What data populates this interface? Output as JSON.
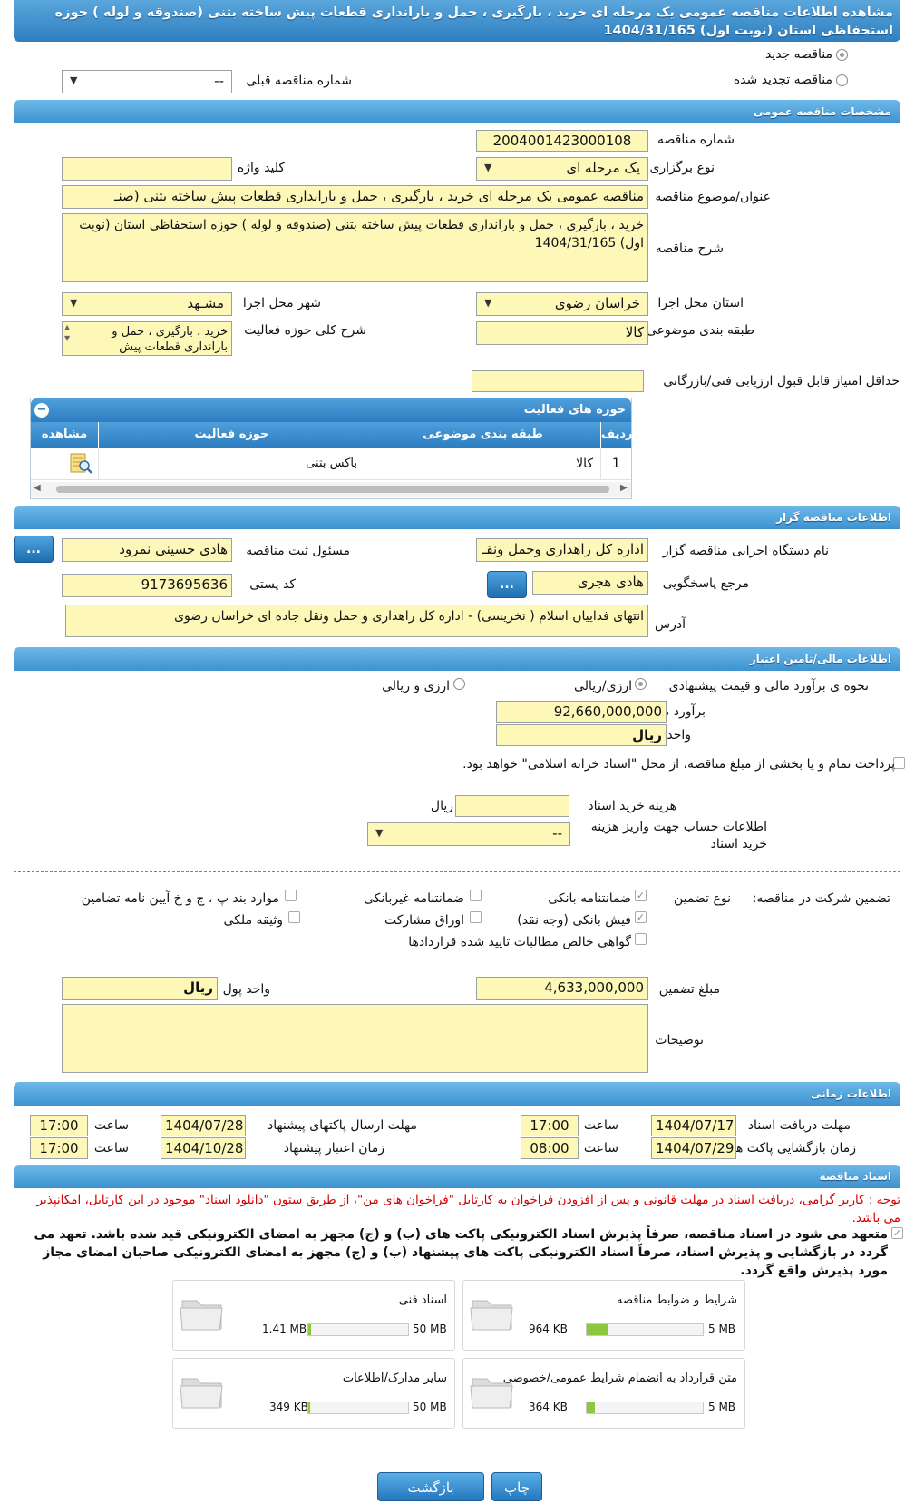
{
  "header": {
    "title": "مشاهده اطلاعات مناقصه عمومی یک مرحله ای خرید ، بارگیری ، حمل و بارانداری قطعات پیش ساخته بتنی (صندوقه و لوله ) حوزه استحفاظی استان (نوبت اول) 1404/31/165"
  },
  "tender_kind": {
    "new_label": "مناقصه جدید",
    "renewed_label": "مناقصه تجدید شده",
    "previous_number_label": "شماره مناقصه قبلی",
    "previous_number_value": "--"
  },
  "general": {
    "section_title": "مشخصات مناقصه عمومی",
    "number_label": "شماره مناقصه",
    "number_value": "2004001423000108",
    "holding_type_label": "نوع برگزاری",
    "holding_type_value": "یک مرحله ای",
    "keyword_label": "کلید واژه",
    "keyword_value": "",
    "subject_label": "عنوان/موضوع مناقصه",
    "subject_value": "مناقصه عمومی یک مرحله ای خرید ، بارگیری ، حمل و بارانداری قطعات پیش ساخته بتنی (صنـ",
    "description_label": "شرح مناقصه",
    "description_value": "خرید ، بارگیری ، حمل و بارانداری قطعات پیش ساخته بتنی (صندوقه و لوله ) حوزه استحفاظی استان (نوبت اول) 1404/31/165",
    "province_label": "استان محل اجرا",
    "province_value": "خراسان رضوی",
    "city_label": "شهر محل اجرا",
    "city_value": "مشـهد",
    "category_label": "طبقه بندی موضوعی",
    "category_value": "کالا",
    "activity_desc_label": "شرح کلی حوزه فعالیت",
    "activity_desc_value": "خرید ، بارگیری ، حمل و بارانداری قطعات پیش",
    "min_score_label": "حداقل امتیاز قابل قبول ارزیابی فنی/بازرگانی",
    "min_score_value": ""
  },
  "activity_grid": {
    "title": "حوزه های فعالیت",
    "columns": [
      "ردیف",
      "طبقه بندی موضوعی",
      "حوزه فعالیت",
      "مشاهده"
    ],
    "rows": [
      {
        "row": "1",
        "category": "کالا",
        "field": "باکس بتنی"
      }
    ]
  },
  "organizer": {
    "section_title": "اطلاعات مناقصه گزار",
    "org_name_label": "نام دستگاه اجرایی مناقصه گزار",
    "org_name_value": "اداره کل راهداری وحمل ونقـ",
    "registrar_label": "مسئول ثبت مناقصه",
    "registrar_value": "هادی حسینی نمرود",
    "responder_label": "مرجع پاسخگویی",
    "responder_value": "هادی هجری",
    "postal_code_label": "کد پستی",
    "postal_code_value": "9173695636",
    "address_label": "آدرس",
    "address_value": "انتهای فداییان اسلام ( نخریسی) - اداره کل راهداری و حمل ونقل جاده ای خراسان رضوی",
    "dots_label": "..."
  },
  "finance": {
    "section_title": "اطلاعات مالی/تامین اعتبار",
    "method_label": "نحوه ی برآورد مالی و قیمت پیشنهادی",
    "option_currency_rial": "ارزی/ریالی",
    "option_currency_and_rial": "ارزی و ریالی",
    "estimate_label": "برآورد مالی",
    "estimate_value": "92,660,000,000",
    "currency_label": "واحد پول",
    "currency_value": "ریال",
    "treasury_note": "پرداخت تمام و یا بخشی از مبلغ مناقصه، از محل \"اسناد خزانه اسلامی\" خواهد بود.",
    "doc_fee_label": "هزینه خرید اسناد",
    "doc_fee_value": "",
    "doc_fee_unit": "ریال",
    "account_label": "اطلاعات حساب جهت واریز هزینه خرید اسناد",
    "account_value": "--"
  },
  "guarantee": {
    "participation_label": "تضمین شرکت در مناقصه:",
    "type_label": "نوع تضمین",
    "options": {
      "bank_guarantee": "ضمانتنامه بانکی",
      "non_bank_guarantee": "ضمانتنامه غیربانکی",
      "regulation_items": "موارد بند پ ، ج و خ آیین نامه تضامین",
      "bank_receipt": "فیش بانکی (وجه نقد)",
      "participation_bonds": "اوراق مشارکت",
      "property_collateral": "وثیقه ملکی",
      "receivables_certificate": "گواهی خالص مطالبات تایید شده قراردادها"
    },
    "amount_label": "مبلغ تضمین",
    "amount_value": "4,633,000,000",
    "currency_label": "واحد پول",
    "currency_value": "ریال",
    "notes_label": "توضیحات",
    "notes_value": ""
  },
  "timing": {
    "section_title": "اطلاعات زمانی",
    "doc_receive_label": "مهلت دریافت اسناد",
    "doc_receive_date": "1404/07/17",
    "doc_receive_time": "17:00",
    "send_deadline_label": "مهلت ارسال پاکتهای پیشنهاد",
    "send_deadline_date": "1404/07/28",
    "send_deadline_time": "17:00",
    "opening_label": "زمان بازگشایی پاکت ها",
    "opening_date": "1404/07/29",
    "opening_time": "08:00",
    "validity_label": "زمان اعتبار پیشنهاد",
    "validity_date": "1404/10/28",
    "validity_time": "17:00",
    "time_label": "ساعت"
  },
  "documents": {
    "section_title": "اسناد مناقصه",
    "notice": "توجه : کاربر گرامی، دریافت اسناد در مهلت قانونی و پس از افزودن فراخوان به کارتابل \"فراخوان های من\"، از طریق ستون \"دانلود اسناد\" موجود در این کارتابل، امکانپذیر می باشد.",
    "commitment": "متعهد می شود در اسناد مناقصه، صرفاً پذیرش اسناد الکترونیکی پاکت های (ب) و (ج) مجهز به امضای الکترونیکی قید شده باشد. تعهد می گردد در بازگشایی و پذیرش اسناد، صرفاً اسناد الکترونیکی پاکت های پیشنهاد (ب) و (ج) مجهز به امضای الکترونیکی صاحبان امضای مجاز مورد پذیرش واقع گردد.",
    "cards": [
      {
        "name": "شرایط و ضوابط مناقصه",
        "size": "964 KB",
        "max": "5 MB",
        "fill": 0.19
      },
      {
        "name": "اسناد فنی",
        "size": "1.41 MB",
        "max": "50 MB",
        "fill": 0.03
      },
      {
        "name": "متن قرارداد به انضمام شرایط عمومی/خصوصی",
        "size": "364 KB",
        "max": "5 MB",
        "fill": 0.07
      },
      {
        "name": "سایر مدارک/اطلاعات",
        "size": "349 KB",
        "max": "50 MB",
        "fill": 0.01
      }
    ]
  },
  "actions": {
    "print_label": "چاپ",
    "back_label": "بازگشت"
  },
  "colors": {
    "section_blue": "#3d92cf",
    "field_yellow": "#fdf8b8",
    "progress_green": "#8dc63f"
  }
}
